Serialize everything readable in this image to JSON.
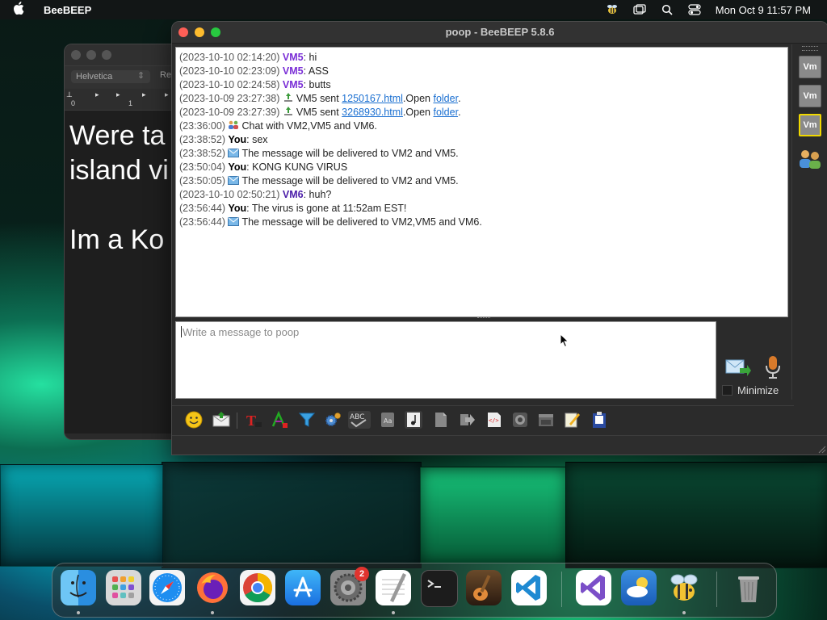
{
  "menubar": {
    "app_name": "BeeBEEP",
    "clock": "Mon Oct 9  11:57 PM"
  },
  "textedit": {
    "font_name": "Helvetica",
    "style_fragment": "Re",
    "ruler_marks": [
      "0",
      "1"
    ],
    "lines": [
      "Were ta",
      "island vi",
      "",
      "Im a Ko"
    ]
  },
  "window": {
    "title": "poop - BeeBEEP 5.8.6"
  },
  "chat": {
    "messages": [
      {
        "time": "(2023-10-10 02:14:20)",
        "sender": "VM5",
        "text": ": hi"
      },
      {
        "time": "(2023-10-10 02:23:09)",
        "sender": "VM5",
        "text": ": ASS"
      },
      {
        "time": "(2023-10-10 02:24:58)",
        "sender": "VM5",
        "text": ": butts"
      },
      {
        "time": "(2023-10-09 23:27:38)",
        "text": "VM5 sent ",
        "link": "1250167.html",
        "after": ".Open ",
        "link2": "folder",
        "end": "."
      },
      {
        "time": "(2023-10-09 23:27:39)",
        "text": "VM5 sent ",
        "link": "3268930.html",
        "after": ".Open ",
        "link2": "folder",
        "end": "."
      },
      {
        "time": "(23:36:00)",
        "text": "Chat with VM2,VM5 and VM6."
      },
      {
        "time": "(23:38:52)",
        "sender": "You",
        "text": ": sex"
      },
      {
        "time": "(23:38:52)",
        "text": "The message will be delivered to VM2 and VM5."
      },
      {
        "time": "(23:50:04)",
        "sender": "You",
        "text": ": KONG KUNG VIRUS"
      },
      {
        "time": "(23:50:05)",
        "text": "The message will be delivered to VM2 and VM5."
      },
      {
        "time": "(2023-10-10 02:50:21)",
        "sender": "VM6",
        "text": ": huh?"
      },
      {
        "time": "(23:56:44)",
        "sender": "You",
        "text": ": The virus is gone at 11:52am EST!"
      },
      {
        "time": "(23:56:44)",
        "text": "The message will be delivered to VM2,VM5 and VM6."
      }
    ]
  },
  "compose": {
    "placeholder": "Write a message to poop",
    "minimize_label": "Minimize"
  },
  "users": {
    "buttons": [
      "Vm",
      "Vm",
      "Vm"
    ],
    "selected_index": 2
  },
  "dock": {
    "settings_badge": "2"
  },
  "colors": {
    "accent_link": "#1a6fd1",
    "vm5_name": "#7a2ed6",
    "vm6_name": "#4a1ca8",
    "selected_user_border": "#f0d800"
  }
}
